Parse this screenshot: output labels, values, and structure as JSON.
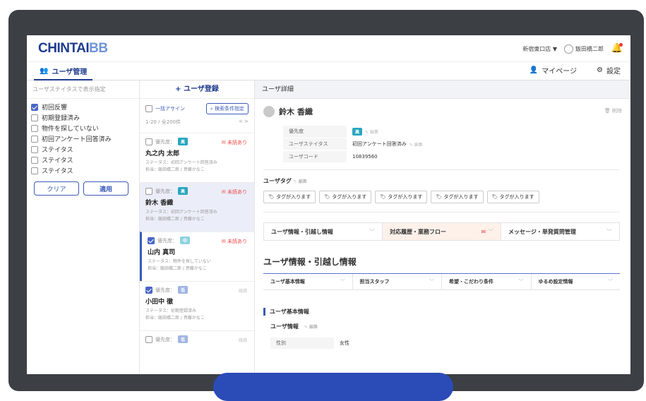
{
  "app": {
    "logo_part1": "CHINTAI",
    "logo_part2": "BB"
  },
  "topbar": {
    "store": "新宿東口店 ▼",
    "user": "飯田橋二郎"
  },
  "nav": {
    "active_tab": "ユーザ管理",
    "mypage": "マイページ",
    "settings": "設定"
  },
  "filter": {
    "header": "ユーザステイタスで表示指定",
    "items": [
      {
        "label": "初回反響",
        "checked": true
      },
      {
        "label": "初期登録済み",
        "checked": false
      },
      {
        "label": "物件を探していない",
        "checked": false
      },
      {
        "label": "初回アンケート回答済み",
        "checked": false
      },
      {
        "label": "ステイタス",
        "checked": false
      },
      {
        "label": "ステイタス",
        "checked": false
      },
      {
        "label": "ステイタス",
        "checked": false
      }
    ],
    "clear": "クリア",
    "apply": "適用"
  },
  "list": {
    "add_user": "+ ユーザ登録",
    "bulk_assign": "一括アサイン",
    "search_cond": "検索条件指定",
    "count": "1-20 / 全200件",
    "pager": "<  >",
    "priority_label": "優先度：",
    "cards": [
      {
        "priority": "高",
        "badge": "hi",
        "checked": false,
        "flag": "未読あり",
        "name": "丸之内 太郎",
        "status": "ステータス：初回アンケート回答済み",
        "staff": "担当：飯田橋二郎 / 斉藤かなこ"
      },
      {
        "priority": "高",
        "badge": "hi",
        "checked": false,
        "flag": "未読あり",
        "name": "鈴木 香織",
        "status": "ステータス：初回アンケート回答済み",
        "staff": "担当：飯田橋二郎 / 斉藤かなこ"
      },
      {
        "priority": "中",
        "badge": "mid",
        "checked": true,
        "flag": "未読あり",
        "name": "山内 真司",
        "status": "ステータス：物件を探していない",
        "staff": "担当：飯田橋二郎 / 斉藤かなこ"
      },
      {
        "priority": "低",
        "badge": "lo",
        "checked": true,
        "flag": "既読",
        "name": "小田中 徹",
        "status": "ステータス：初期登録済み",
        "staff": "担当：飯田橋二郎 / 斉藤かなこ"
      },
      {
        "priority": "低",
        "badge": "lo",
        "checked": false,
        "flag": "既読",
        "name": "",
        "status": "",
        "staff": ""
      }
    ]
  },
  "detail": {
    "header": "ユーザ詳細",
    "name": "鈴木 香織",
    "delete": "削除",
    "rows": [
      {
        "key": "優先度",
        "value": "高",
        "edit": "編集"
      },
      {
        "key": "ユーザステイタス",
        "value": "初回アンケート回答済み",
        "edit": "編集"
      },
      {
        "key": "ユーザコード",
        "value": "10839560",
        "edit": ""
      }
    ],
    "tag_title": "ユーザタグ",
    "tag_edit": "編集",
    "tags": [
      "タグが入ります",
      "タグが入ります",
      "タグが入ります",
      "タグが入ります",
      "タグが入ります"
    ],
    "big_tabs": [
      "ユーザ情報・引越し情報",
      "対応履歴・業務フロー",
      "メッセージ・単発質問管理"
    ],
    "section_title": "ユーザ情報・引越し情報",
    "sub_tabs": [
      "ユーザ基本情報",
      "担当スタッフ",
      "希望・こだわり条件",
      "ゆるめ設定情報"
    ],
    "basic_title": "ユーザ基本情報",
    "user_info_title": "ユーザ情報",
    "user_info_edit": "編集",
    "gender_key": "性別",
    "gender_value": "女性"
  },
  "colors": {
    "brand": "#1f3b8f",
    "accent": "#3b5bb8",
    "alert": "#e44444"
  }
}
